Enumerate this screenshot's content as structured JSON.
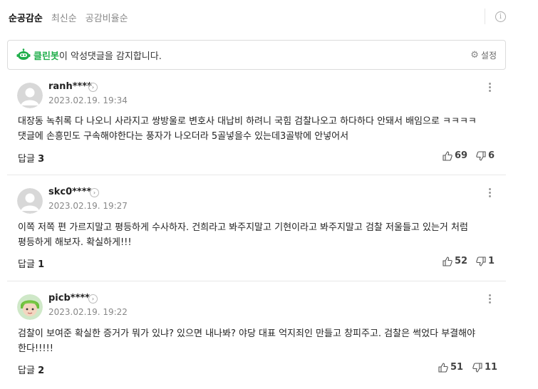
{
  "tabs": [
    "순공감순",
    "최신순",
    "공감비율순"
  ],
  "cleanbot": {
    "brand": "클린봇",
    "text": "이 악성댓글을 감지합니다.",
    "settings_label": "설정"
  },
  "reply_label": "답글",
  "comments": [
    {
      "nickname": "ranh****",
      "date": "2023.02.19. 19:34",
      "body": "대장동 녹취록 다 나오니 사라지고 쌍방울로 변호사 대납비 하려니 국힘 검찰나오고 하다하다 안돼서 배임으로 ㅋㅋㅋㅋ\n댓글에 손흥민도 구속해야한다는 풍자가 나오더라 5골넣을수 있는데3골밖에 안넣어서",
      "replies": "3",
      "likes": "69",
      "dislikes": "6",
      "avatar": "default"
    },
    {
      "nickname": "skc0****",
      "date": "2023.02.19. 19:27",
      "body": "이쪽 저쪽 편 가르지말고 평등하게 수사하자. 건희라고 봐주지말고 기현이라고 봐주지말고 검찰 저울들고 있는거 처럼\n평등하게 해보자. 확실하게!!!",
      "replies": "1",
      "likes": "52",
      "dislikes": "1",
      "avatar": "default"
    },
    {
      "nickname": "picb****",
      "date": "2023.02.19. 19:22",
      "body": "검찰이 보여준 확실한 증거가 뭐가 있냐? 있으면 내나봐? 야당 대표 억지죄인 만들고 창피주고. 검찰은 썩었다 부결해야\n한다!!!!!",
      "replies": "2",
      "likes": "51",
      "dislikes": "11",
      "avatar": "character"
    }
  ],
  "colors": {
    "brand_green": "#1fae4a",
    "divider": "#e8e8e8",
    "muted": "#888888"
  }
}
